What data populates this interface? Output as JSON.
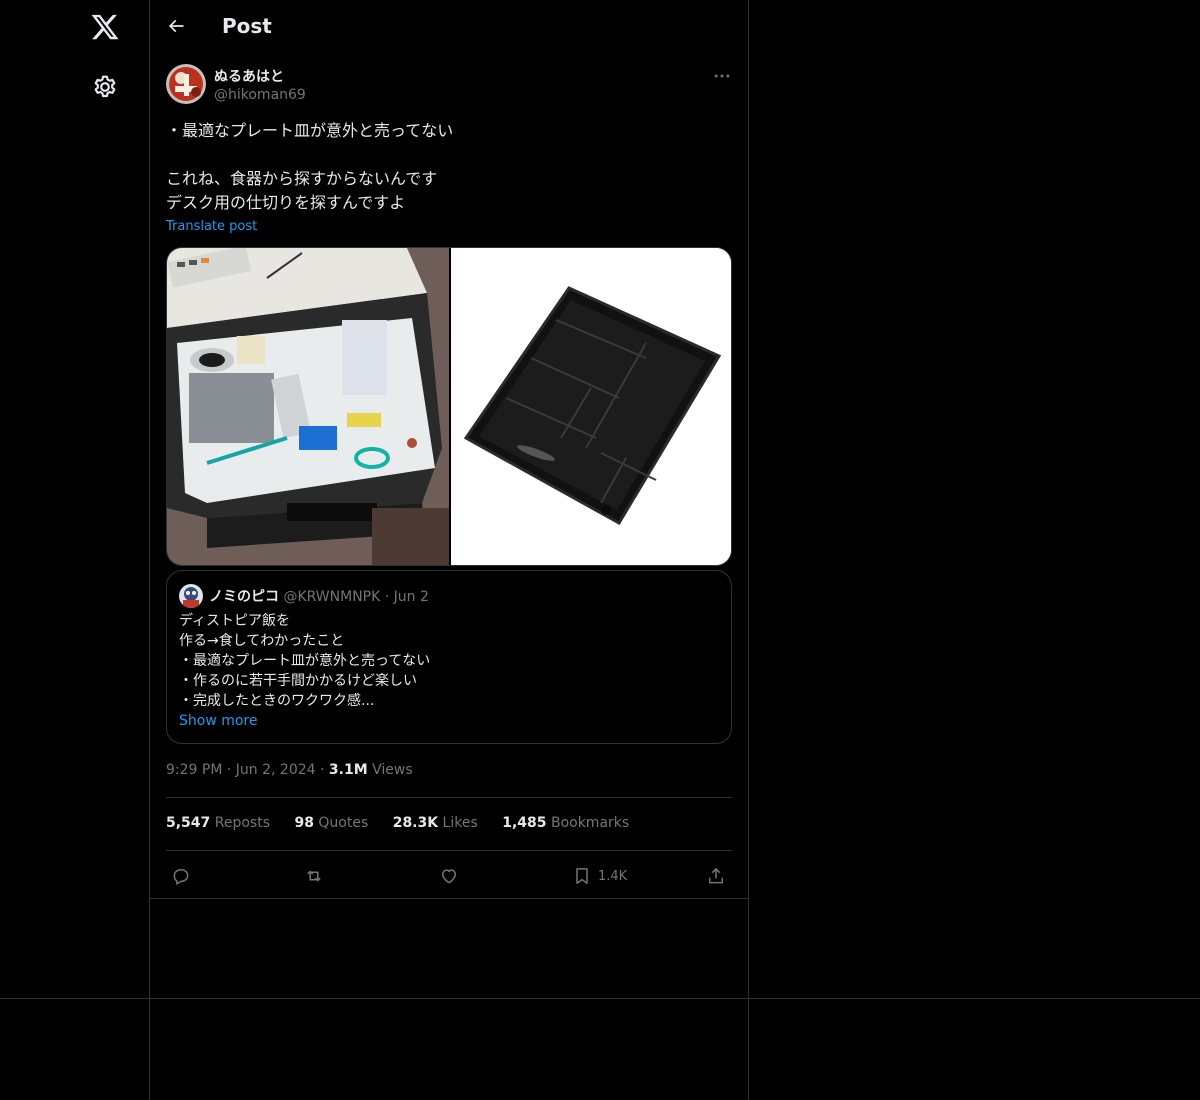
{
  "nav": {
    "logo_icon": "x-logo-icon",
    "settings_icon": "gear-icon"
  },
  "header": {
    "title": "Post"
  },
  "post": {
    "author_name": "ぬるあはと",
    "author_handle": "@hikoman69",
    "text_lines": [
      "・最適なプレート皿が意外と売ってない",
      "",
      "これね、食器から探すからないんです",
      "デスク用の仕切りを探すんですよ"
    ],
    "translate_label": "Translate post",
    "media": [
      "desk drawer organizer photo",
      "black plastic tray photo"
    ]
  },
  "quote": {
    "name": "ノミのピコ",
    "handle": "@KRWNMNPK",
    "date": "Jun 2",
    "lines": [
      "ディストピア飯を",
      "作る→食してわかったこと",
      "・最適なプレート皿が意外と売ってない",
      "・作るのに若干手間かかるけど楽しい",
      "・完成したときのワクワク感..."
    ],
    "show_more": "Show more"
  },
  "meta": {
    "time": "9:29 PM",
    "date": "Jun 2, 2024",
    "views_count": "3.1M",
    "views_label": "Views"
  },
  "stats": {
    "reposts_count": "5,547",
    "reposts_label": "Reposts",
    "quotes_count": "98",
    "quotes_label": "Quotes",
    "likes_count": "28.3K",
    "likes_label": "Likes",
    "bookmarks_count": "1,485",
    "bookmarks_label": "Bookmarks"
  },
  "actions": {
    "bookmark_count": "1.4K"
  },
  "colors": {
    "background": "#000000",
    "text": "#e7e9ea",
    "muted": "#71767b",
    "link": "#1d9bf0",
    "border": "#2f3336"
  }
}
